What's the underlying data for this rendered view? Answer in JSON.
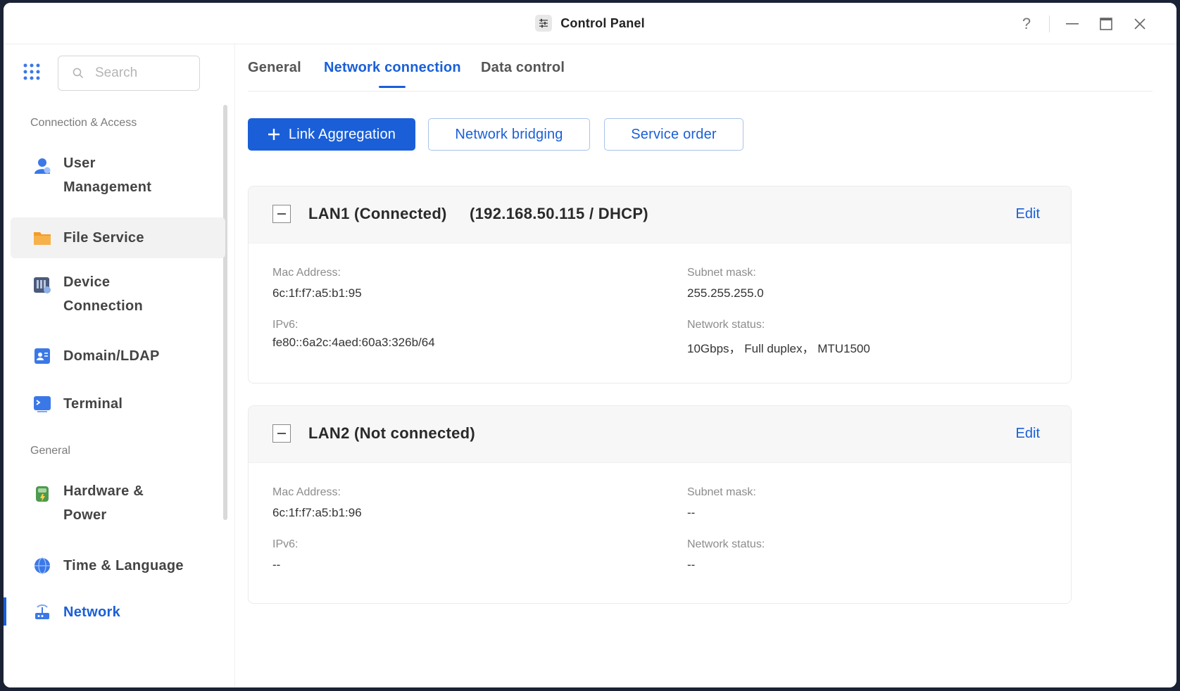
{
  "window": {
    "title": "Control Panel",
    "help_symbol": "?"
  },
  "sidebar": {
    "search_placeholder": "Search",
    "sections": [
      {
        "label": "Connection & Access",
        "items": [
          {
            "label_line1": "User",
            "label_line2": "Management",
            "icon": "user-icon"
          },
          {
            "label_line1": "File Service",
            "icon": "folder-icon"
          },
          {
            "label_line1": "Device",
            "label_line2": "Connection",
            "icon": "device-icon"
          },
          {
            "label_line1": "Domain/LDAP",
            "icon": "domain-icon"
          },
          {
            "label_line1": "Terminal",
            "icon": "terminal-icon"
          }
        ]
      },
      {
        "label": "General",
        "items": [
          {
            "label_line1": "Hardware &",
            "label_line2": "Power",
            "icon": "hardware-icon"
          },
          {
            "label_line1": "Time & Language",
            "icon": "globe-icon"
          },
          {
            "label_line1": "Network",
            "icon": "network-icon",
            "selected": true
          }
        ]
      }
    ]
  },
  "main": {
    "tabs": [
      {
        "label": "General"
      },
      {
        "label": "Network connection",
        "active": true
      },
      {
        "label": "Data control"
      }
    ],
    "actions": {
      "link_aggregation": "Link Aggregation",
      "network_bridging": "Network bridging",
      "service_order": "Service order"
    },
    "lans": [
      {
        "title": "LAN1 (Connected)",
        "ip": "(192.168.50.115 / DHCP)",
        "edit": "Edit",
        "mac_label": "Mac Address:",
        "mac": "6c:1f:f7:a5:b1:95",
        "ipv6_label": "IPv6:",
        "ipv6": "fe80::6a2c:4aed:60a3:326b/64",
        "subnet_label": "Subnet mask:",
        "subnet": "255.255.255.0",
        "status_label": "Network status:",
        "status": "10Gbps， Full duplex， MTU1500"
      },
      {
        "title": "LAN2 (Not connected)",
        "ip": "",
        "edit": "Edit",
        "mac_label": "Mac Address:",
        "mac": "6c:1f:f7:a5:b1:96",
        "ipv6_label": "IPv6:",
        "ipv6": "--",
        "subnet_label": "Subnet mask:",
        "subnet": "--",
        "status_label": "Network status:",
        "status": "--"
      }
    ]
  },
  "colors": {
    "accent": "#1a5fd8",
    "selected_bg": "#f2f2f2",
    "card_header_bg": "#f7f7f7"
  }
}
